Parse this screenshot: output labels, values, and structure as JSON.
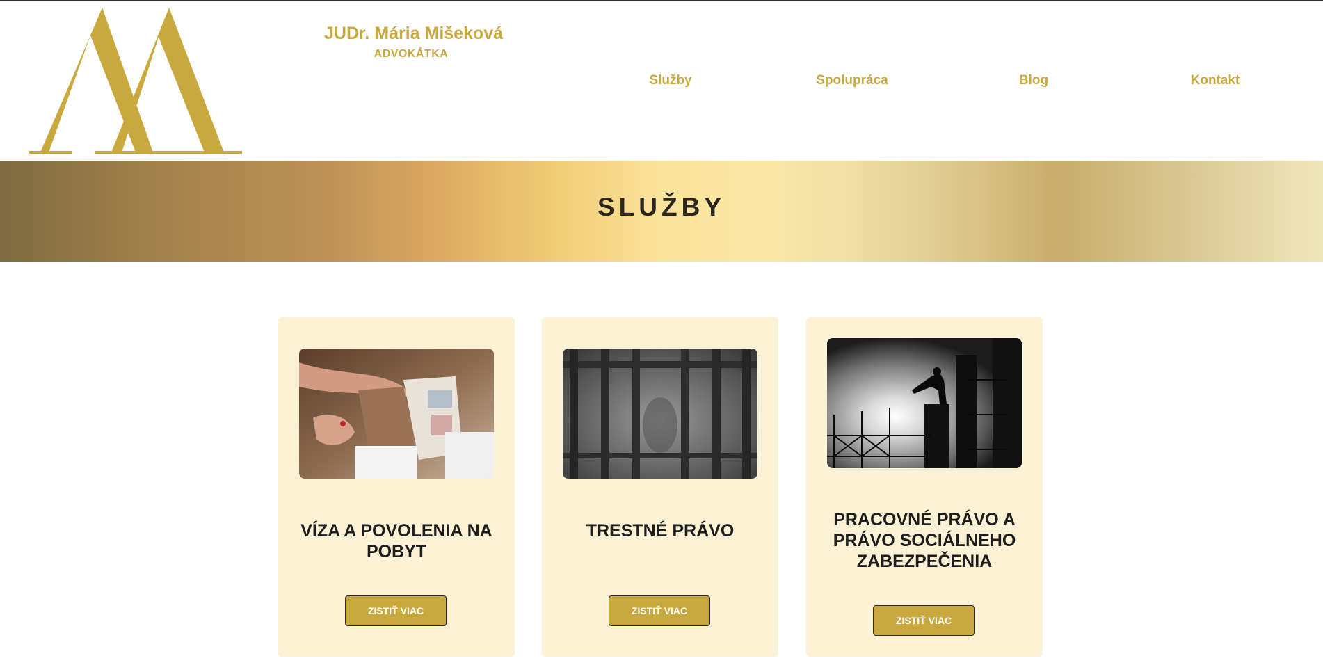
{
  "header": {
    "brand_name": "JUDr. Mária Mišeková",
    "brand_subtitle": "ADVOKÁTKA",
    "brand_color": "#c9a83d",
    "nav": [
      {
        "label": "Služby"
      },
      {
        "label": "Spolupráca"
      },
      {
        "label": "Blog"
      },
      {
        "label": "Kontakt"
      }
    ]
  },
  "banner": {
    "title": "SLUŽBY"
  },
  "cards": [
    {
      "title": "VÍZA A POVOLENIA NA POBYT",
      "button_label": "ZISTIŤ VIAC",
      "image": "passport-photo"
    },
    {
      "title": "TRESTNÉ PRÁVO",
      "button_label": "ZISTIŤ VIAC",
      "image": "prison-bars-photo"
    },
    {
      "title": "PRACOVNÉ PRÁVO A PRÁVO SOCIÁLNEHO ZABEZPEČENIA",
      "button_label": "ZISTIŤ VIAC",
      "image": "construction-worker-photo"
    }
  ],
  "colors": {
    "accent": "#c9a83d",
    "card_background": "#fbf1d4",
    "heading_text": "#1e1e1e"
  }
}
